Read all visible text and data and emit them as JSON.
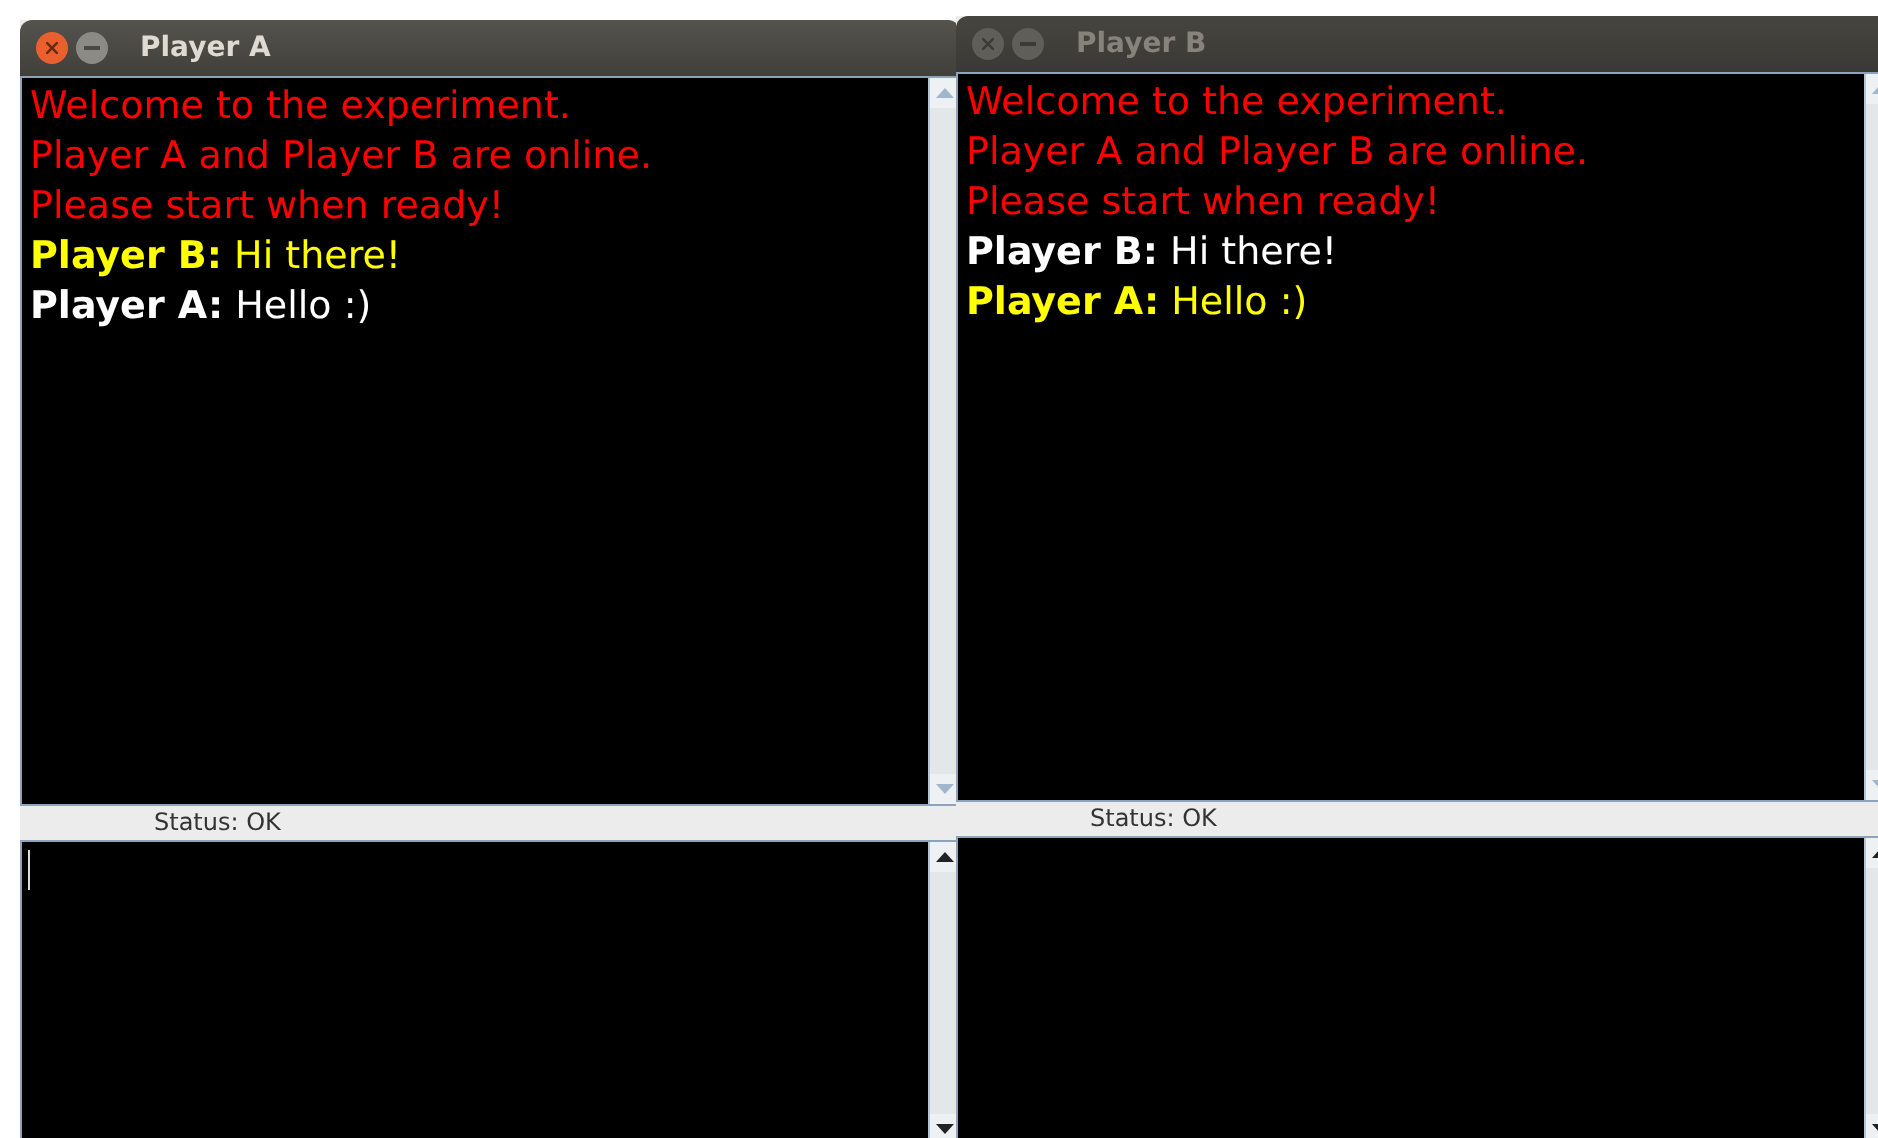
{
  "windows": [
    {
      "title": "Player A",
      "active": true,
      "messages": [
        {
          "kind": "system",
          "text": "Welcome to the experiment."
        },
        {
          "kind": "system",
          "text": "Player A and Player B are online."
        },
        {
          "kind": "system",
          "text": "Please start when ready!"
        },
        {
          "kind": "chat",
          "sender": "Player B:",
          "text": "Hi there!",
          "highlighted": true
        },
        {
          "kind": "chat",
          "sender": "Player A:",
          "text": "Hello :)",
          "highlighted": false
        }
      ],
      "status": "Status: OK",
      "input_focused": true
    },
    {
      "title": "Player B",
      "active": false,
      "messages": [
        {
          "kind": "system",
          "text": "Welcome to the experiment."
        },
        {
          "kind": "system",
          "text": "Player A and Player B are online."
        },
        {
          "kind": "system",
          "text": "Please start when ready!"
        },
        {
          "kind": "chat",
          "sender": "Player B:",
          "text": "Hi there!",
          "highlighted": false
        },
        {
          "kind": "chat",
          "sender": "Player A:",
          "text": "Hello :)",
          "highlighted": true
        }
      ],
      "status": "Status: OK",
      "input_focused": false
    }
  ]
}
